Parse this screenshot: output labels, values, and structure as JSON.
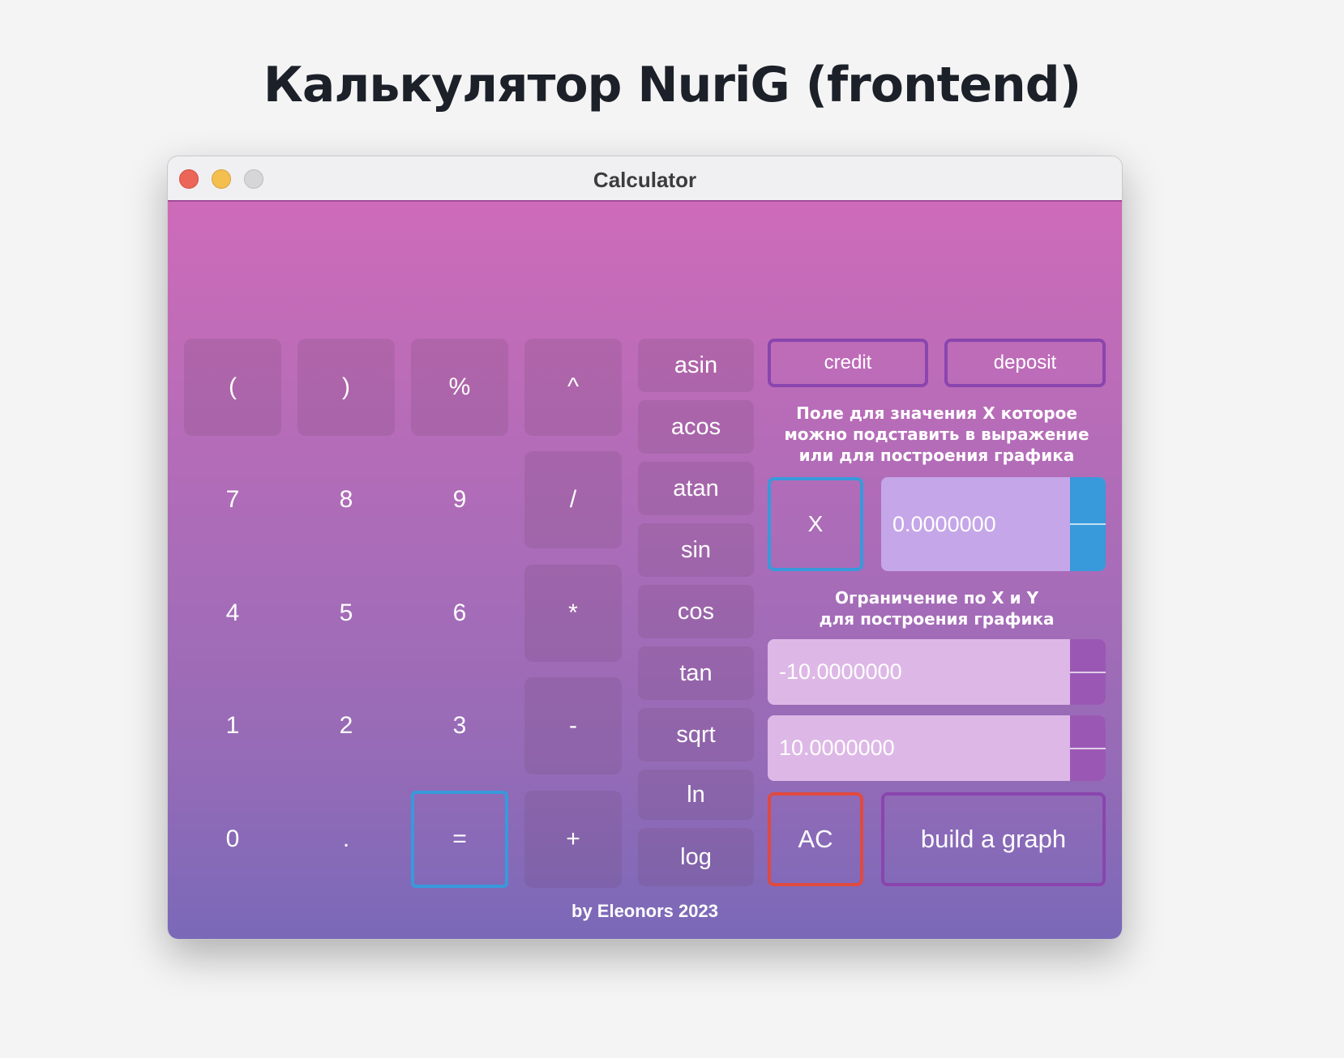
{
  "page_title": "Калькулятор NuriG (frontend)",
  "window": {
    "title": "Calculator"
  },
  "keys": {
    "lparen": "(",
    "rparen": ")",
    "percent": "%",
    "pow": "^",
    "seven": "7",
    "eight": "8",
    "nine": "9",
    "div": "/",
    "four": "4",
    "five": "5",
    "six": "6",
    "mul": "*",
    "one": "1",
    "two": "2",
    "three": "3",
    "minus": "-",
    "zero": "0",
    "dot": ".",
    "equals": "=",
    "plus": "+"
  },
  "functions": [
    "asin",
    "acos",
    "atan",
    "sin",
    "cos",
    "tan",
    "sqrt",
    "ln",
    "log"
  ],
  "panel": {
    "credit": "credit",
    "deposit": "deposit",
    "x_label_lines": [
      "Поле для значения X которое",
      "можно подставить в выражение",
      "или для построения графика"
    ],
    "x_button": "X",
    "x_value": "0.0000000",
    "range_label_lines": [
      "Ограничение по X и Y",
      "для построения графика"
    ],
    "min_value": "-10.0000000",
    "max_value": "10.0000000",
    "ac": "AC",
    "build_graph": "build a graph"
  },
  "footer": "by Eleonors 2023",
  "colors": {
    "accent_blue": "#3899db",
    "ac_red": "#e04a3f",
    "outline_purple": "#8a45ae"
  }
}
